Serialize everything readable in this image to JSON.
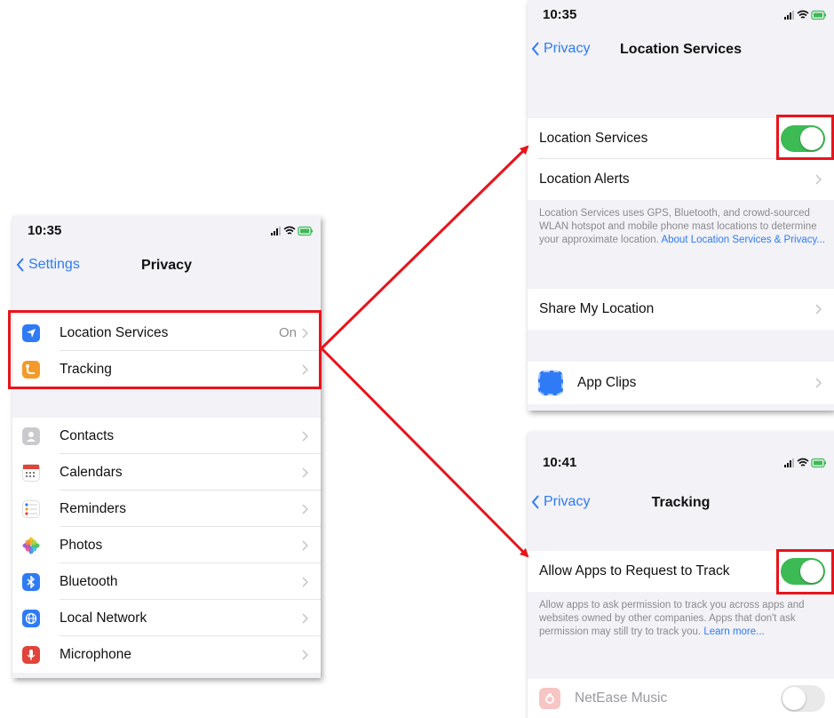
{
  "screen_privacy": {
    "time": "10:35",
    "back_label": "Settings",
    "title": "Privacy",
    "top_group": [
      {
        "label": "Location Services",
        "value": "On",
        "icon": "location-arrow-icon",
        "color": "#2f7bf5"
      },
      {
        "label": "Tracking",
        "icon": "tracking-icon",
        "color": "#f39a2b"
      }
    ],
    "app_group": [
      {
        "label": "Contacts",
        "icon": "contacts-icon",
        "color": "#c9c9ce"
      },
      {
        "label": "Calendars",
        "icon": "calendar-icon",
        "color": "#ffffff"
      },
      {
        "label": "Reminders",
        "icon": "reminders-icon",
        "color": "#ffffff"
      },
      {
        "label": "Photos",
        "icon": "photos-icon",
        "color": "#ffffff"
      },
      {
        "label": "Bluetooth",
        "icon": "bluetooth-icon",
        "color": "#2f7bf5"
      },
      {
        "label": "Local Network",
        "icon": "globe-icon",
        "color": "#2f7bf5"
      },
      {
        "label": "Microphone",
        "icon": "microphone-icon",
        "color": "#e0443a"
      }
    ]
  },
  "screen_location": {
    "time": "10:35",
    "back_label": "Privacy",
    "title": "Location Services",
    "toggle_label": "Location Services",
    "toggle_on": true,
    "alerts_label": "Location Alerts",
    "footnote_text": "Location Services uses GPS, Bluetooth, and crowd-sourced WLAN hotspot and mobile phone mast locations to determine your approximate location.",
    "footnote_link": "About Location Services & Privacy...",
    "share_label": "Share My Location",
    "app_clips_label": "App Clips"
  },
  "screen_tracking": {
    "time": "10:41",
    "back_label": "Privacy",
    "title": "Tracking",
    "toggle_label": "Allow Apps to Request to Track",
    "toggle_on": true,
    "footnote_text": "Allow apps to ask permission to track you across apps and websites owned by other companies. Apps that don't ask permission may still try to track you.",
    "footnote_link": "Learn more...",
    "app_label": "NetEase Music",
    "app_toggle_on": false
  },
  "colors": {
    "highlight": "#e8141b",
    "accent_blue": "#2f7bf5",
    "toggle_green": "#3cba54"
  }
}
